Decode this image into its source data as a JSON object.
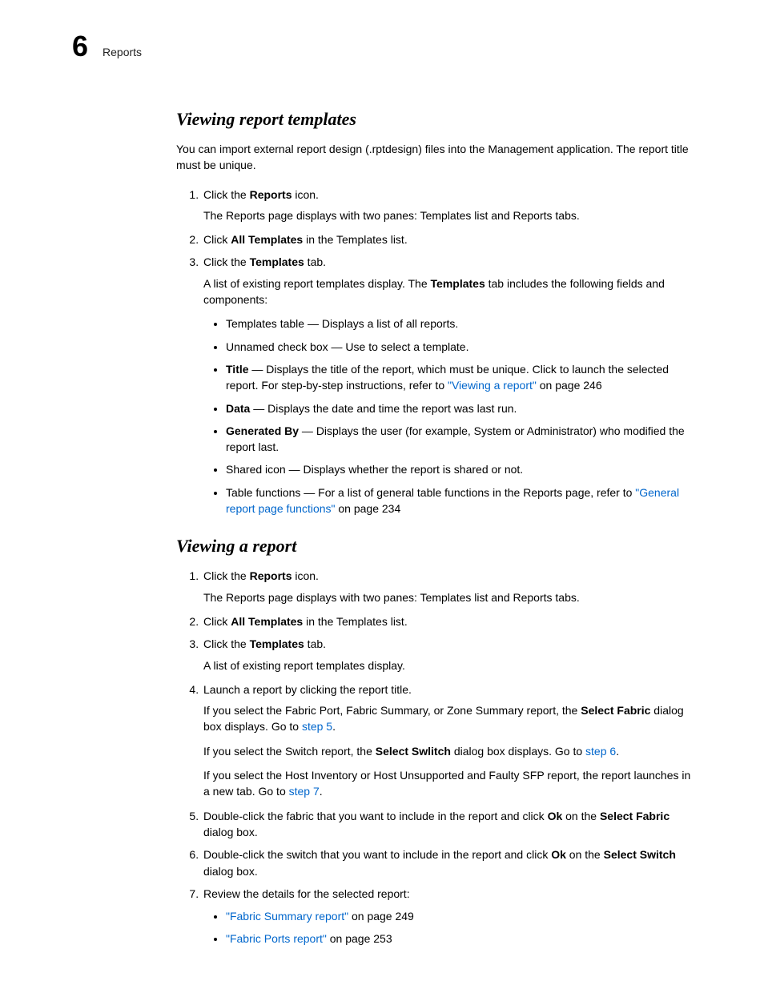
{
  "header": {
    "chapter_number": "6",
    "chapter_title": "Reports"
  },
  "section1": {
    "heading": "Viewing report templates",
    "intro": "You can import external report design (.rptdesign) files into the Management application. The report title must be unique.",
    "steps": {
      "s1_pre": "Click the ",
      "s1_bold": "Reports",
      "s1_post": " icon.",
      "s1_sub": "The Reports page displays with two panes: Templates list and Reports tabs.",
      "s2_pre": "Click ",
      "s2_bold": "All Templates",
      "s2_post": " in the Templates list.",
      "s3_pre": "Click the ",
      "s3_bold": "Templates",
      "s3_post": " tab.",
      "s3_sub_pre": "A list of existing report templates display. The ",
      "s3_sub_bold": "Templates",
      "s3_sub_post": " tab includes the following fields and components:"
    },
    "bullets": {
      "b1": "Templates table — Displays a list of all reports.",
      "b2": "Unnamed check box — Use to select a template.",
      "b3_bold": "Title",
      "b3_text": " — Displays the title of the report, which must be unique. Click to launch the selected report. For step-by-step instructions, refer to ",
      "b3_link": "\"Viewing a report\"",
      "b3_post": " on page 246",
      "b4_bold": "Data",
      "b4_text": " — Displays the date and time the report was last run.",
      "b5_bold": "Generated By",
      "b5_text": " — Displays the user (for example, System or Administrator) who modified the report last.",
      "b6": "Shared icon — Displays whether the report is shared or not.",
      "b7_pre": "Table functions — For a list of general table functions in the Reports page, refer to ",
      "b7_link": "\"General report page functions\"",
      "b7_post": " on page 234"
    }
  },
  "section2": {
    "heading": "Viewing a report",
    "steps": {
      "s1_pre": "Click the ",
      "s1_bold": "Reports",
      "s1_post": " icon.",
      "s1_sub": "The Reports page displays with two panes: Templates list and Reports tabs.",
      "s2_pre": "Click ",
      "s2_bold": "All Templates",
      "s2_post": " in the Templates list.",
      "s3_pre": "Click the ",
      "s3_bold": "Templates",
      "s3_post": " tab.",
      "s3_sub": "A list of existing report templates display.",
      "s4": "Launch a report by clicking the report title.",
      "s4_sub1_pre": "If you select the Fabric Port, Fabric Summary, or Zone Summary report, the ",
      "s4_sub1_bold": "Select Fabric",
      "s4_sub1_post": " dialog box displays. Go to ",
      "s4_sub1_link": "step 5",
      "s4_sub1_end": ".",
      "s4_sub2_pre": "If you select the Switch report, the ",
      "s4_sub2_bold": "Select Swlitch",
      "s4_sub2_post": " dialog box displays. Go to ",
      "s4_sub2_link": "step 6",
      "s4_sub2_end": ".",
      "s4_sub3_pre": "If you select the Host Inventory or Host Unsupported and Faulty SFP report, the report launches in a new tab. Go to ",
      "s4_sub3_link": "step 7",
      "s4_sub3_end": ".",
      "s5_pre": "Double-click the fabric that you want to include in the report and click ",
      "s5_bold1": "Ok",
      "s5_mid": " on the ",
      "s5_bold2": "Select Fabric",
      "s5_post": " dialog box.",
      "s6_pre": "Double-click the switch that you want to include in the report and click ",
      "s6_bold1": "Ok",
      "s6_mid": " on the ",
      "s6_bold2": "Select Switch",
      "s6_post": " dialog box.",
      "s7": "Review the details for the selected report:"
    },
    "bullets": {
      "b1_link": "\"Fabric Summary report\"",
      "b1_post": " on page 249",
      "b2_link": "\"Fabric Ports report\"",
      "b2_post": " on page 253"
    }
  }
}
